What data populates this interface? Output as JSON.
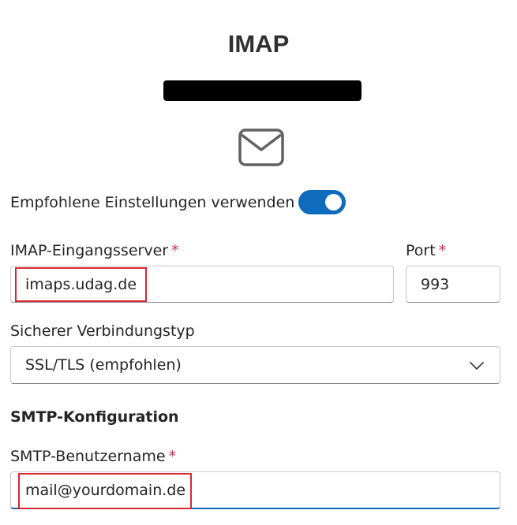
{
  "title": "IMAP",
  "toggle": {
    "label": "Empfohlene Einstellungen verwenden",
    "state": "on"
  },
  "incoming_server": {
    "label": "IMAP-Eingangsserver",
    "required_marker": "*",
    "value": "imaps.udag.de"
  },
  "port": {
    "label": "Port",
    "required_marker": "*",
    "value": "993"
  },
  "security": {
    "label": "Sicherer Verbindungstyp",
    "selected": "SSL/TLS (empfohlen)"
  },
  "smtp": {
    "section_title": "SMTP-Konfiguration",
    "username_label": "SMTP-Benutzername",
    "required_marker": "*",
    "username_value": "mail@yourdomain.de"
  },
  "icons": {
    "mail": "mail-icon",
    "dropdown": "chevron-down-icon"
  },
  "colors": {
    "accent": "#0f6cbd",
    "required": "#c4314b",
    "highlight": "#d62732"
  }
}
